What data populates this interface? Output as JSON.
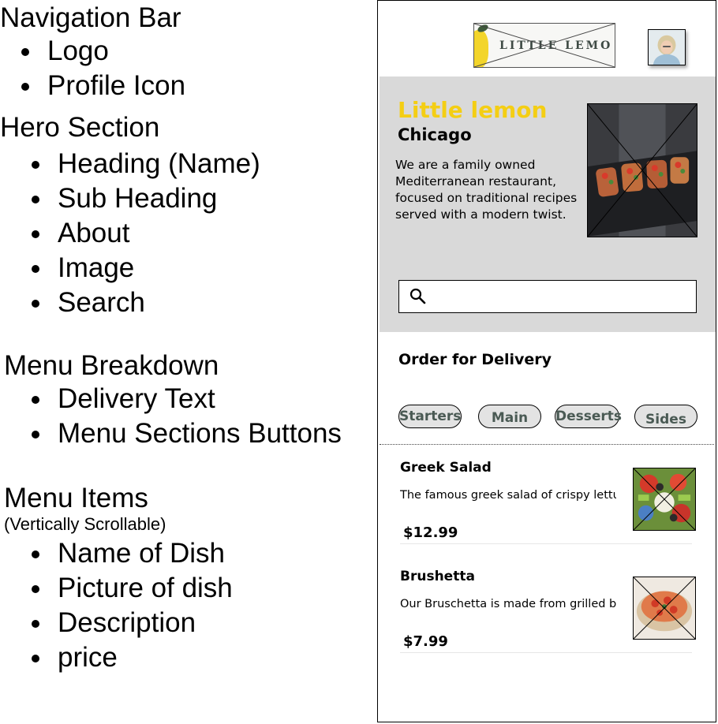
{
  "annotations": {
    "navigation": {
      "title": "Navigation Bar",
      "items": [
        "Logo",
        "Profile Icon"
      ]
    },
    "hero": {
      "title": "Hero Section",
      "items": [
        "Heading (Name)",
        "Sub Heading",
        "About",
        "Image",
        "Search"
      ]
    },
    "menu_breakdown": {
      "title": "Menu Breakdown",
      "items": [
        "Delivery Text",
        "Menu Sections Buttons"
      ]
    },
    "menu_items": {
      "title": "Menu Items",
      "subtitle": "(Vertically Scrollable)",
      "items": [
        "Name of Dish",
        "Picture of dish",
        "Description",
        "price"
      ]
    }
  },
  "phone": {
    "logo_text": "LITTLE LEMO",
    "colors": {
      "hero_bg": "#d9d9d9",
      "accent_yellow": "#f4ce14",
      "pill_bg": "#e3e3e3"
    },
    "hero": {
      "title": "Little lemon",
      "city": "Chicago",
      "about": "We are a family owned Mediterranean restaurant, focused on traditional recipes served with a modern twist.",
      "search_icon": "search-icon"
    },
    "delivery_heading": "Order for Delivery",
    "sections": [
      "Starters",
      "Main",
      "Desserts",
      "Sides"
    ],
    "items": [
      {
        "name": "Greek Salad",
        "description": "The famous greek salad of crispy lettuce, peppers, olives and our Chica",
        "price": "$12.99"
      },
      {
        "name": "Brushetta",
        "description": "Our Bruschetta is made from grilled bread that has been smeared with ga",
        "price": "$7.99"
      }
    ]
  }
}
